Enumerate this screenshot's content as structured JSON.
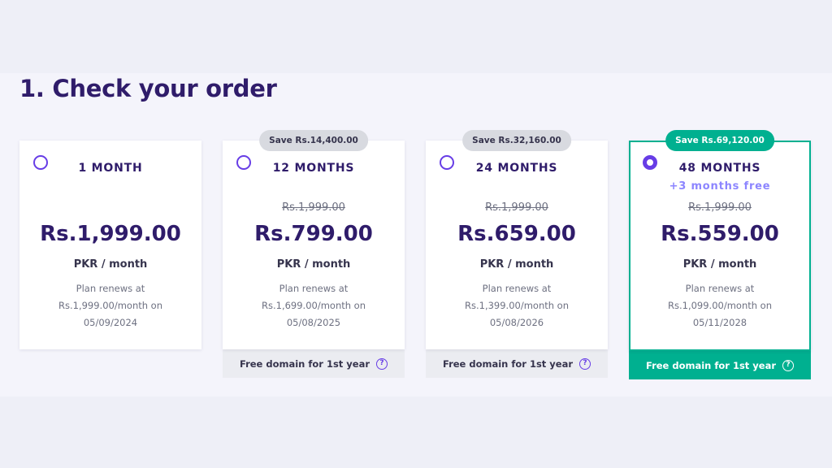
{
  "page": {
    "title": "1. Check your order"
  },
  "plans": [
    {
      "name": "1 MONTH",
      "price": "Rs.1,999.00",
      "unit": "PKR / month",
      "renew_line1": "Plan renews at",
      "renew_line2": "Rs.1,999.00/month on",
      "renew_line3": "05/09/2024",
      "selected": false
    },
    {
      "name": "12 MONTHS",
      "save": "Save Rs.14,400.00",
      "old_price": "Rs.1,999.00",
      "price": "Rs.799.00",
      "unit": "PKR / month",
      "renew_line1": "Plan renews at",
      "renew_line2": "Rs.1,699.00/month on",
      "renew_line3": "05/08/2025",
      "domain": "Free domain for 1st year",
      "selected": false
    },
    {
      "name": "24 MONTHS",
      "save": "Save Rs.32,160.00",
      "old_price": "Rs.1,999.00",
      "price": "Rs.659.00",
      "unit": "PKR / month",
      "renew_line1": "Plan renews at",
      "renew_line2": "Rs.1,399.00/month on",
      "renew_line3": "05/08/2026",
      "domain": "Free domain for 1st year",
      "selected": false
    },
    {
      "name": "48 MONTHS",
      "bonus": "+3 months free",
      "save": "Save Rs.69,120.00",
      "old_price": "Rs.1,999.00",
      "price": "Rs.559.00",
      "unit": "PKR / month",
      "renew_line1": "Plan renews at",
      "renew_line2": "Rs.1,099.00/month on",
      "renew_line3": "05/11/2028",
      "domain": "Free domain for 1st year",
      "selected": true
    }
  ],
  "icons": {
    "help": "question-circle-icon",
    "help_glyph": "?"
  },
  "colors": {
    "accent": "#673de6",
    "selected": "#00b090",
    "heading": "#2f1c6a"
  }
}
